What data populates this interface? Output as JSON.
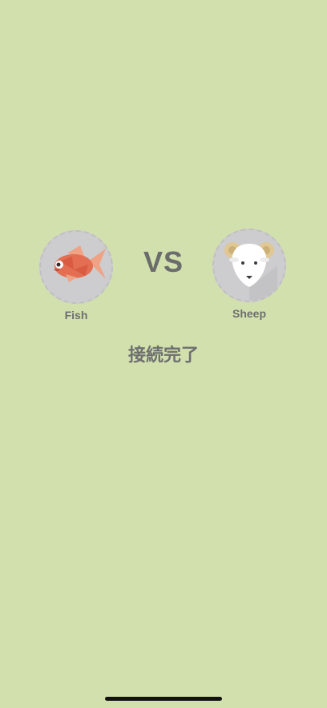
{
  "match": {
    "left_player": {
      "name": "Fish",
      "avatar_icon": "goldfish-icon"
    },
    "right_player": {
      "name": "Sheep",
      "avatar_icon": "ram-icon"
    },
    "vs_label": "VS",
    "status_text": "接続完了"
  },
  "colors": {
    "background": "#d2e0ad",
    "text": "#6d6f6f",
    "avatar_ring": "#cdcdcf",
    "fish_body": "#e36e52",
    "fish_fin": "#f0a285"
  }
}
